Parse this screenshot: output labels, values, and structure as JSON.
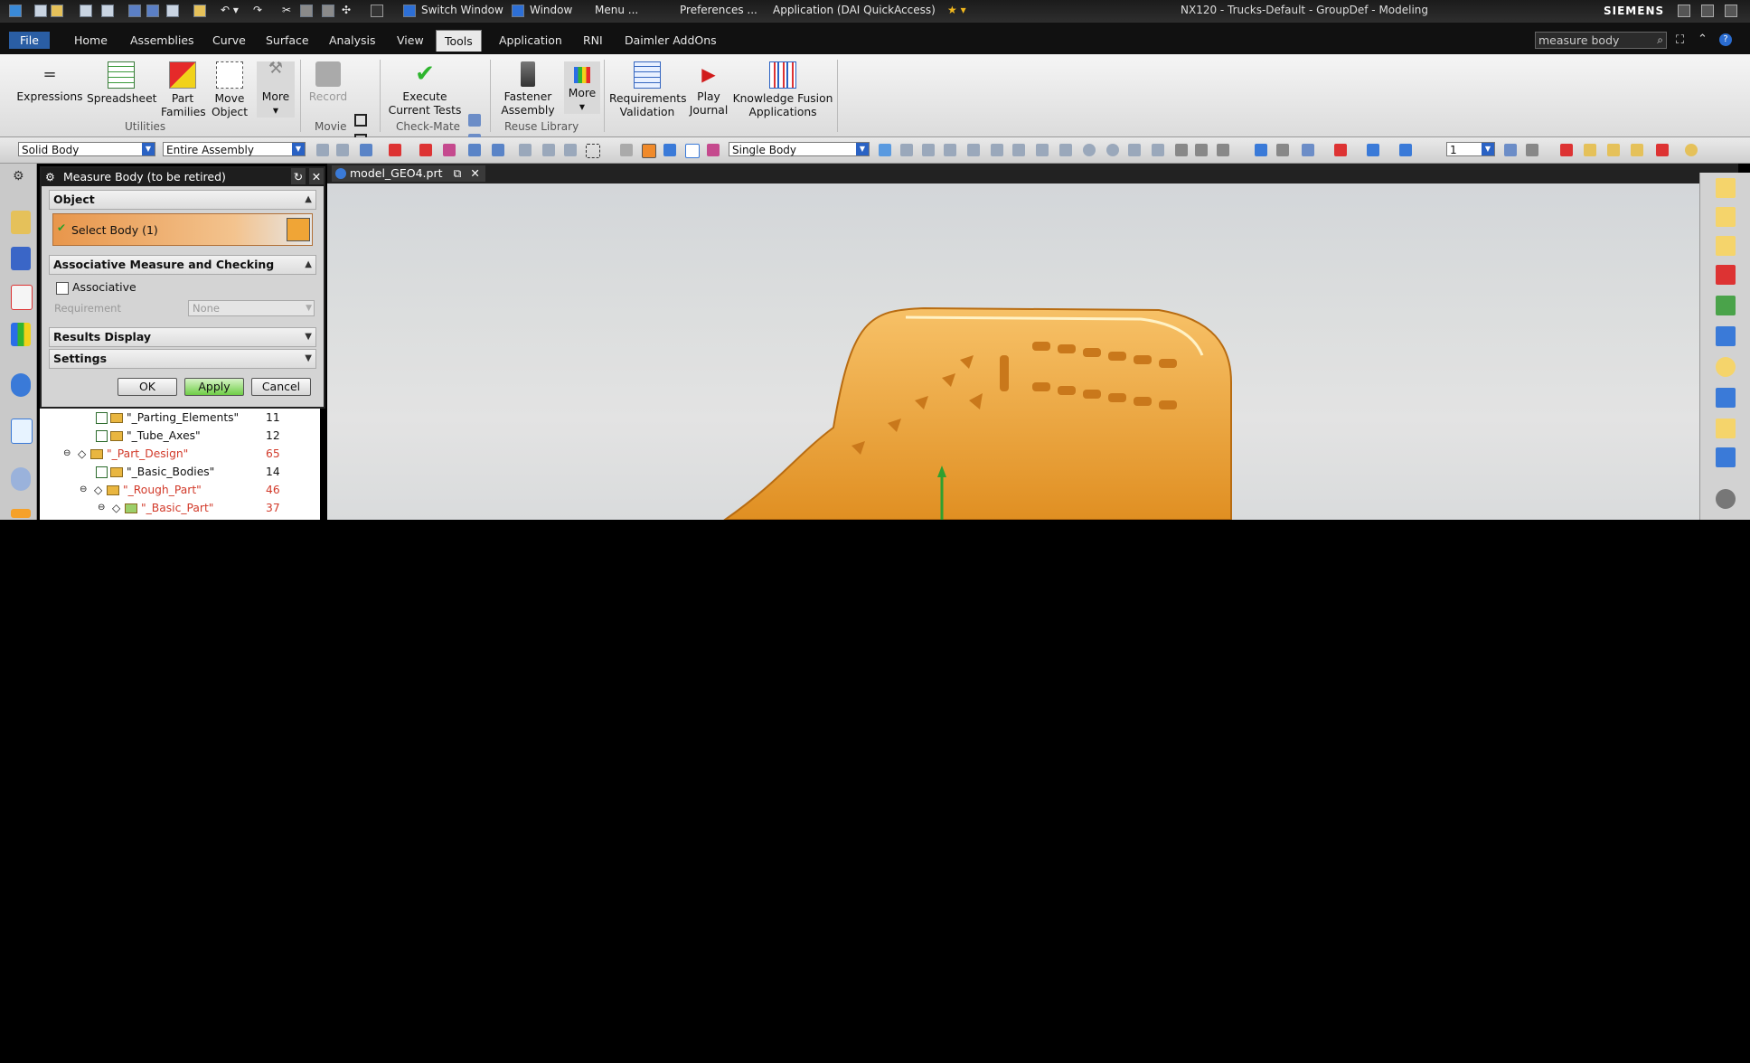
{
  "titlebar": {
    "quick_access": [
      "Switch Window",
      "Window",
      "Menu ...",
      "Preferences ...",
      "Application (DAI QuickAccess)"
    ],
    "title": "NX120 - Trucks-Default - GroupDef - Modeling",
    "brand": "SIEMENS",
    "search_value": "measure body"
  },
  "tabs": [
    "File",
    "Home",
    "Assemblies",
    "Curve",
    "Surface",
    "Analysis",
    "View",
    "Tools",
    "Application",
    "RNI",
    "Daimler AddOns"
  ],
  "active_tab": "Tools",
  "ribbon": {
    "buttons": [
      {
        "label1": "Expressions",
        "label2": "",
        "icon": "expressions-icon"
      },
      {
        "label1": "Spreadsheet",
        "label2": "",
        "icon": "spreadsheet-icon"
      },
      {
        "label1": "Part",
        "label2": "Families",
        "icon": "part-families-icon"
      },
      {
        "label1": "Move",
        "label2": "Object",
        "icon": "move-object-icon"
      },
      {
        "label1": "More",
        "label2": "▾",
        "icon": "more-icon"
      },
      {
        "label1": "Record",
        "label2": "",
        "icon": "record-icon"
      },
      {
        "label1": "Execute",
        "label2": "Current Tests",
        "icon": "execute-tests-icon"
      },
      {
        "label1": "Fastener",
        "label2": "Assembly",
        "icon": "fastener-icon"
      },
      {
        "label1": "More",
        "label2": "▾",
        "icon": "more-icon-2"
      },
      {
        "label1": "Requirements",
        "label2": "Validation",
        "icon": "requirements-icon"
      },
      {
        "label1": "Play",
        "label2": "Journal",
        "icon": "play-journal-icon"
      },
      {
        "label1": "Knowledge Fusion",
        "label2": "Applications",
        "icon": "knowledge-fusion-icon"
      }
    ],
    "groups": [
      "Utilities",
      "Movie",
      "Check-Mate",
      "Reuse Library"
    ]
  },
  "selection_bar": {
    "filter": "Solid Body",
    "scope": "Entire Assembly",
    "body_rule": "Single Body",
    "layer": "1"
  },
  "dialog": {
    "title": "Measure Body (to be retired)",
    "object_section": "Object",
    "select_body": "Select Body (1)",
    "assoc_section": "Associative Measure and Checking",
    "associative_label": "Associative",
    "requirement_label": "Requirement",
    "requirement_value": "None",
    "results_section": "Results Display",
    "settings_section": "Settings",
    "ok": "OK",
    "apply": "Apply",
    "cancel": "Cancel"
  },
  "tree": [
    {
      "name": "\"_Parting_Elements\"",
      "count": "11",
      "color": "#111"
    },
    {
      "name": "\"_Tube_Axes\"",
      "count": "12",
      "color": "#111"
    },
    {
      "name": "\"_Part_Design\"",
      "count": "65",
      "color": "#d23a2a"
    },
    {
      "name": "\"_Basic_Bodies\"",
      "count": "14",
      "color": "#111"
    },
    {
      "name": "\"_Rough_Part\"",
      "count": "46",
      "color": "#d23a2a"
    },
    {
      "name": "\"_Basic_Part\"",
      "count": "37",
      "color": "#d23a2a"
    }
  ],
  "viewport": {
    "tab_label": "model_GEO4.prt",
    "model_color": "#f0a536"
  }
}
